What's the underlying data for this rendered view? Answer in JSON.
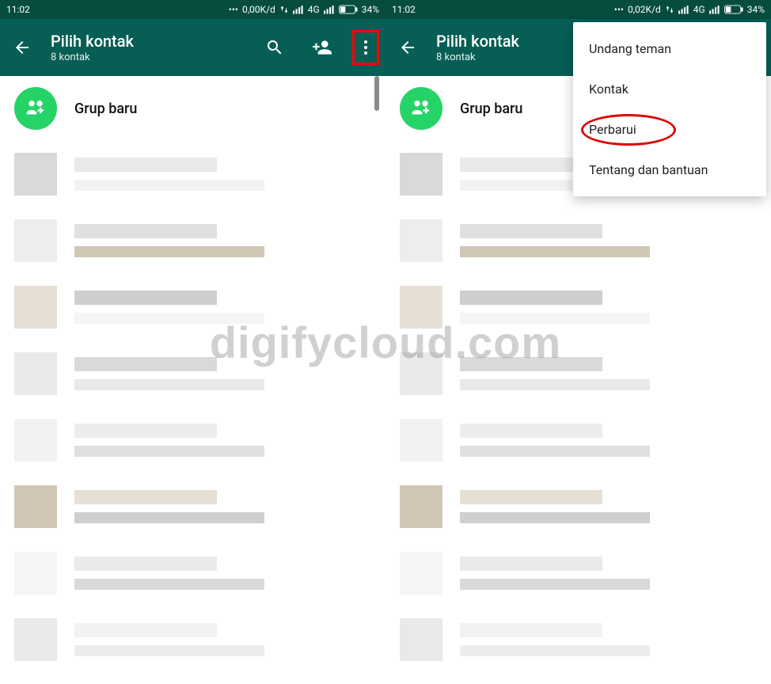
{
  "watermark": "digifycloud.com",
  "left": {
    "statusbar": {
      "time": "11:02",
      "data_rate": "0,00K/d",
      "network": "4G",
      "battery": "34%"
    },
    "appbar": {
      "title": "Pilih kontak",
      "subtitle": "8 kontak",
      "icons": {
        "back": "arrow-back",
        "search": "search",
        "add_contact": "add-person",
        "more": "more-vert"
      },
      "highlight_more": true
    },
    "content": {
      "new_group_label": "Grup baru",
      "scroll_indicator": true,
      "blurred_rows": 8
    }
  },
  "right": {
    "statusbar": {
      "time": "11:02",
      "data_rate": "0,02K/d",
      "network": "4G",
      "battery": "34%"
    },
    "appbar": {
      "title": "Pilih kontak",
      "subtitle": "8 kontak",
      "icons": {
        "back": "arrow-back"
      }
    },
    "content": {
      "new_group_label": "Grup baru",
      "blurred_rows": 8
    },
    "menu": {
      "items": [
        {
          "label": "Undang teman",
          "highlighted": false
        },
        {
          "label": "Kontak",
          "highlighted": false
        },
        {
          "label": "Perbarui",
          "highlighted": true
        },
        {
          "label": "Tentang dan bantuan",
          "highlighted": false
        }
      ]
    }
  },
  "mosaic_palette": [
    "#d9d9d9",
    "#e9e9e9",
    "#f2f2f2",
    "#ededed",
    "#e0e0e0",
    "#d0c7b6",
    "#e6e0d4",
    "#cfcfcf",
    "#f5f5f5",
    "#eaeaea"
  ]
}
